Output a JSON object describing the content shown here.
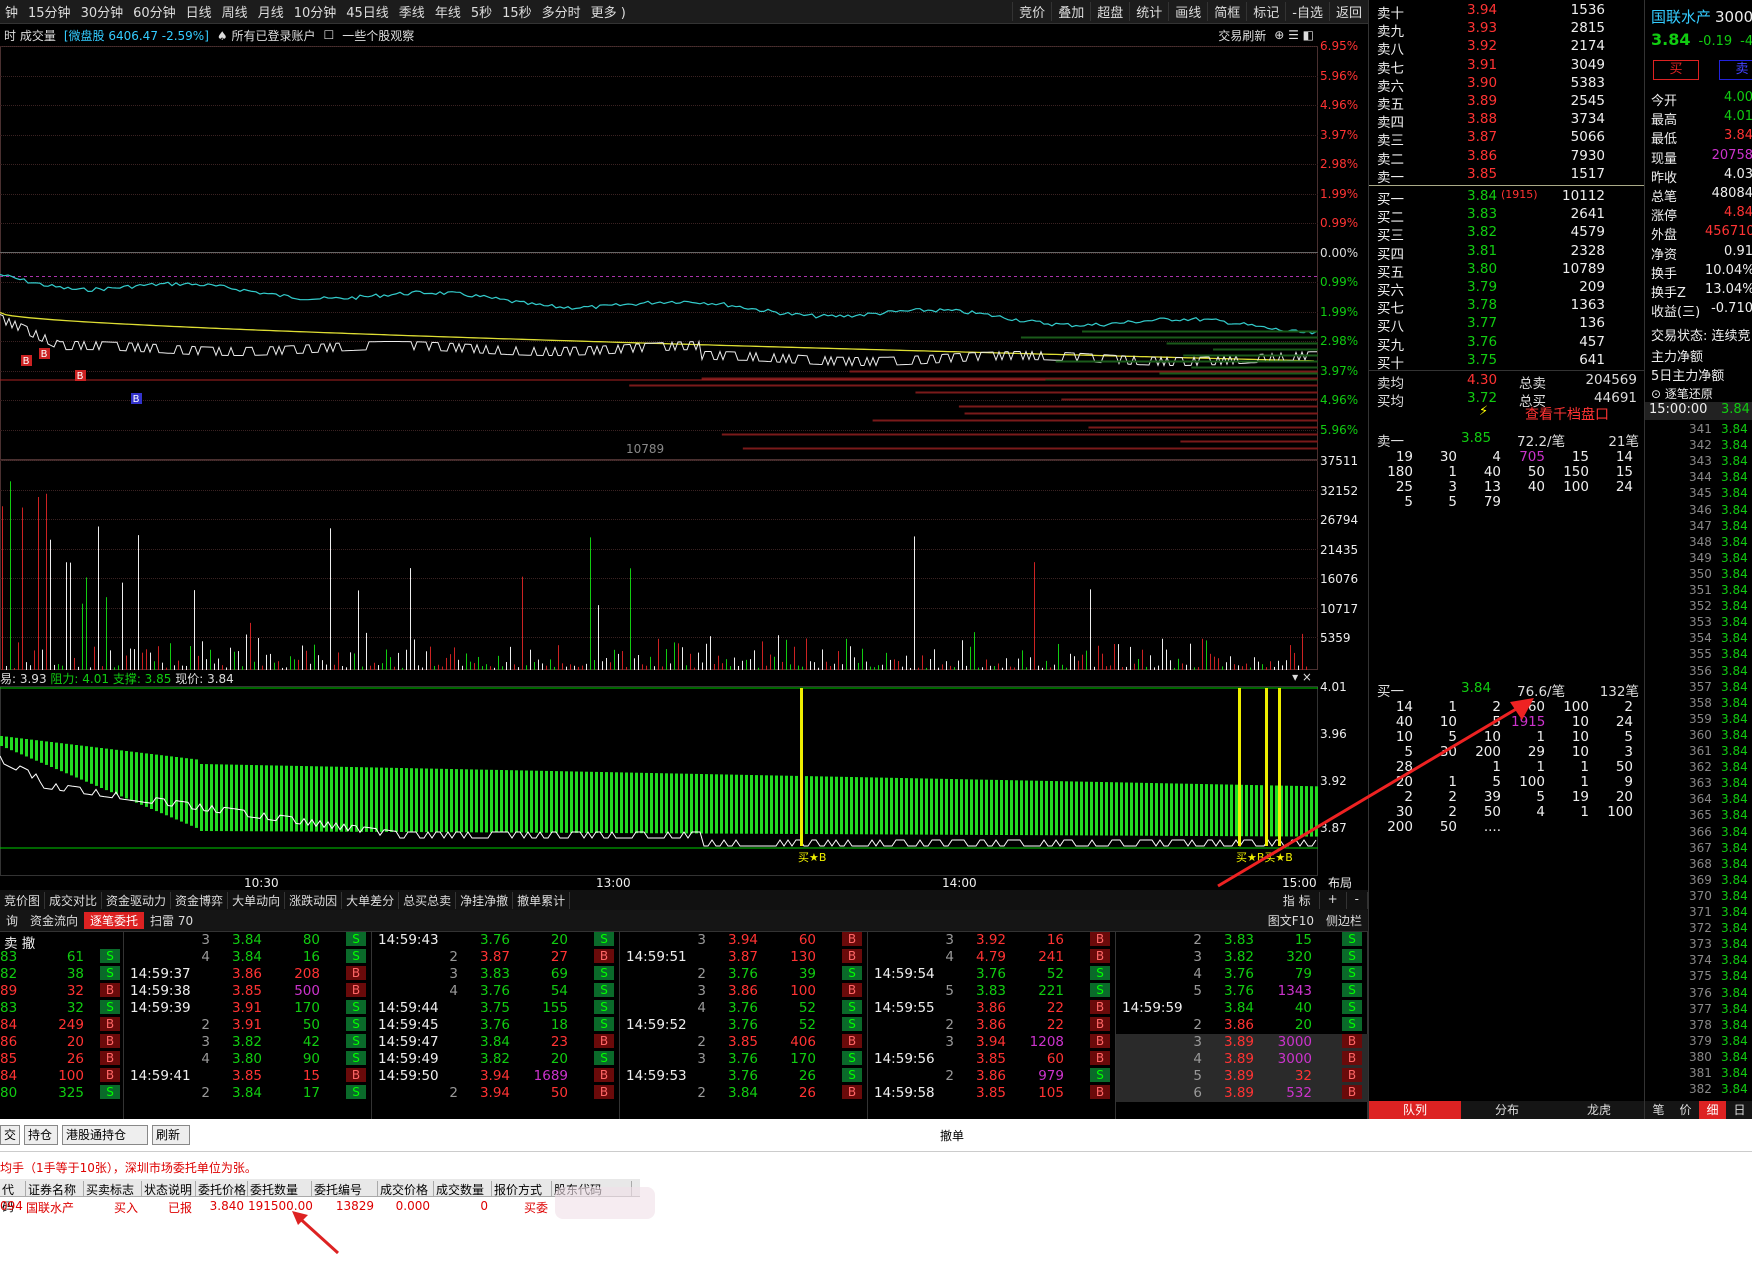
{
  "topbar": {
    "left": [
      "钟",
      "15分钟",
      "30分钟",
      "60分钟",
      "日线",
      "周线",
      "月线",
      "10分钟",
      "45日线",
      "季线",
      "年线",
      "5秒",
      "15秒",
      "多分时",
      "更多 )"
    ],
    "right": [
      "竞价",
      "叠加",
      "超盘",
      "统计",
      "画线",
      "简框",
      "标记",
      "-自选",
      "返回"
    ]
  },
  "infobar": {
    "a": "时 成交量",
    "b": "[微盘股 6406.47 -2.59%]",
    "c": "♠ 所有已登录账户",
    "d": "一些个股观察",
    "e": "交易刷新"
  },
  "price_axis": [
    "6.95%",
    "5.96%",
    "4.96%",
    "3.97%",
    "2.98%",
    "1.99%",
    "0.99%",
    "0.00%",
    "0.99%",
    "1.99%",
    "2.98%",
    "3.97%",
    "4.96%",
    "5.96%"
  ],
  "vol_axis": [
    "37511",
    "32152",
    "26794",
    "21435",
    "16076",
    "10717",
    "5359"
  ],
  "vol_label": "10789",
  "ind_header": {
    "a": "易: 3.93",
    "b": "阻力: 4.01",
    "c": "支撑: 3.85",
    "d": "现价: 3.84"
  },
  "ind_axis": [
    "4.01",
    "3.96",
    "3.92",
    "3.87"
  ],
  "markers": {
    "b1": "B",
    "b2": "B",
    "b3": "B",
    "b4": "B",
    "buy1": "买★B",
    "buy2": "买★B买★B"
  },
  "time_axis": [
    "10:30",
    "13:00",
    "14:00",
    "15:00"
  ],
  "layout_btn": "布局",
  "tabs1": [
    "竞价图",
    "成交对比",
    "资金驱动力",
    "资金博弈",
    "大单动向",
    "涨跌动因",
    "大单差分",
    "总买总卖",
    "净挂净撤",
    "撤单累计"
  ],
  "tabs1_right": [
    "指 标",
    "+",
    "-"
  ],
  "tabs2": [
    "询",
    "资金流向",
    "逐笔委托",
    "扫雷 70"
  ],
  "tabs2_right": [
    "图文F10",
    "侧边栏"
  ],
  "tape": {
    "col0": {
      "header": "卖 撤",
      "rows": [
        [
          "83",
          "61",
          "S"
        ],
        [
          "82",
          "38",
          "S"
        ],
        [
          "89",
          "32",
          "B"
        ],
        [
          "83",
          "32",
          "S"
        ],
        [
          "84",
          "249",
          "B"
        ],
        [
          "86",
          "20",
          "B"
        ],
        [
          "85",
          "26",
          "B"
        ],
        [
          "84",
          "100",
          "B"
        ],
        [
          "80",
          "325",
          "S"
        ]
      ]
    },
    "col1": [
      [
        "",
        "3",
        "3.84",
        "80",
        "S"
      ],
      [
        "",
        "4",
        "3.84",
        "16",
        "S"
      ],
      [
        "14:59:37",
        "",
        "3.86",
        "208",
        "B"
      ],
      [
        "14:59:38",
        "",
        "3.85",
        "500",
        "B"
      ],
      [
        "14:59:39",
        "",
        "3.91",
        "170",
        "S"
      ],
      [
        "",
        "2",
        "3.91",
        "50",
        "S"
      ],
      [
        "",
        "3",
        "3.82",
        "42",
        "S"
      ],
      [
        "",
        "4",
        "3.80",
        "90",
        "S"
      ],
      [
        "14:59:41",
        "",
        "3.85",
        "15",
        "B"
      ],
      [
        "",
        "2",
        "3.84",
        "17",
        "S"
      ]
    ],
    "col2": [
      [
        "14:59:43",
        "",
        "3.76",
        "20",
        "S"
      ],
      [
        "",
        "2",
        "3.87",
        "27",
        "B"
      ],
      [
        "",
        "3",
        "3.83",
        "69",
        "S"
      ],
      [
        "",
        "4",
        "3.76",
        "54",
        "S"
      ],
      [
        "14:59:44",
        "",
        "3.75",
        "155",
        "S"
      ],
      [
        "14:59:45",
        "",
        "3.76",
        "18",
        "S"
      ],
      [
        "14:59:47",
        "",
        "3.84",
        "23",
        "B"
      ],
      [
        "14:59:49",
        "",
        "3.82",
        "20",
        "S"
      ],
      [
        "14:59:50",
        "",
        "3.94",
        "1689",
        "B"
      ],
      [
        "",
        "2",
        "3.94",
        "50",
        "B"
      ]
    ],
    "col3": [
      [
        "",
        "3",
        "3.94",
        "60",
        "B"
      ],
      [
        "14:59:51",
        "",
        "3.87",
        "130",
        "B"
      ],
      [
        "",
        "2",
        "3.76",
        "39",
        "S"
      ],
      [
        "",
        "3",
        "3.86",
        "100",
        "B"
      ],
      [
        "",
        "4",
        "3.76",
        "52",
        "S"
      ],
      [
        "14:59:52",
        "",
        "3.76",
        "52",
        "S"
      ],
      [
        "",
        "2",
        "3.85",
        "406",
        "B"
      ],
      [
        "",
        "3",
        "3.76",
        "170",
        "S"
      ],
      [
        "14:59:53",
        "",
        "3.76",
        "26",
        "S"
      ],
      [
        "",
        "2",
        "3.84",
        "26",
        "B"
      ]
    ],
    "col4": [
      [
        "",
        "3",
        "3.92",
        "16",
        "B"
      ],
      [
        "",
        "4",
        "4.79",
        "241",
        "B"
      ],
      [
        "14:59:54",
        "",
        "3.76",
        "52",
        "S"
      ],
      [
        "",
        "5",
        "3.83",
        "221",
        "S"
      ],
      [
        "14:59:55",
        "",
        "3.86",
        "22",
        "B"
      ],
      [
        "",
        "2",
        "3.86",
        "22",
        "B"
      ],
      [
        "",
        "3",
        "3.94",
        "1208",
        "B"
      ],
      [
        "14:59:56",
        "",
        "3.85",
        "60",
        "B"
      ],
      [
        "",
        "2",
        "3.86",
        "979",
        "S"
      ],
      [
        "14:59:58",
        "",
        "3.85",
        "105",
        "B"
      ]
    ],
    "col5": [
      [
        "",
        "2",
        "3.83",
        "15",
        "S"
      ],
      [
        "",
        "3",
        "3.82",
        "320",
        "S"
      ],
      [
        "",
        "4",
        "3.76",
        "79",
        "S"
      ],
      [
        "",
        "5",
        "3.76",
        "1343",
        "S"
      ],
      [
        "14:59:59",
        "",
        "3.84",
        "40",
        "S"
      ],
      [
        "",
        "2",
        "3.86",
        "20",
        "S"
      ],
      [
        "",
        "3",
        "3.89",
        "3000",
        "B"
      ],
      [
        "",
        "4",
        "3.89",
        "3000",
        "B"
      ],
      [
        "",
        "5",
        "3.89",
        "32",
        "B"
      ],
      [
        "",
        "6",
        "3.89",
        "532",
        "B"
      ]
    ]
  },
  "orderbook": {
    "asks": [
      [
        "卖十",
        "3.94",
        "1536"
      ],
      [
        "卖九",
        "3.93",
        "2815"
      ],
      [
        "卖八",
        "3.92",
        "2174"
      ],
      [
        "卖七",
        "3.91",
        "3049"
      ],
      [
        "卖六",
        "3.90",
        "5383"
      ],
      [
        "卖五",
        "3.89",
        "2545"
      ],
      [
        "卖四",
        "3.88",
        "3734"
      ],
      [
        "卖三",
        "3.87",
        "5066"
      ],
      [
        "卖二",
        "3.86",
        "7930"
      ],
      [
        "卖一",
        "3.85",
        "1517"
      ]
    ],
    "bids": [
      [
        "买一",
        "3.84",
        "10112"
      ],
      [
        "买二",
        "3.83",
        "2641"
      ],
      [
        "买三",
        "3.82",
        "4579"
      ],
      [
        "买四",
        "3.81",
        "2328"
      ],
      [
        "买五",
        "3.80",
        "10789"
      ],
      [
        "买六",
        "3.79",
        "209"
      ],
      [
        "买七",
        "3.78",
        "1363"
      ],
      [
        "买八",
        "3.77",
        "136"
      ],
      [
        "买九",
        "3.76",
        "457"
      ],
      [
        "买十",
        "3.75",
        "641"
      ]
    ],
    "bid1_extra": "(1915)",
    "sell_avg_label": "卖均",
    "sell_avg": "4.30",
    "total_sell_label": "总卖",
    "total_sell": "204569",
    "buy_avg_label": "买均",
    "buy_avg": "3.72",
    "total_buy_label": "总买",
    "total_buy": "44691",
    "view_1000": "查看千档盘口",
    "ask1_queue": {
      "label": "卖一",
      "price": "3.85",
      "avg": "72.2/笔",
      "count": "21笔",
      "rows": [
        [
          "19",
          "30",
          "4",
          "705",
          "15",
          "14"
        ],
        [
          "180",
          "1",
          "40",
          "50",
          "150",
          "15"
        ],
        [
          "25",
          "3",
          "13",
          "40",
          "100",
          "24"
        ],
        [
          "5",
          "5",
          "79",
          "",
          "",
          ""
        ]
      ]
    },
    "bid1_queue": {
      "label": "买一",
      "price": "3.84",
      "avg": "76.6/笔",
      "count": "132笔",
      "rows": [
        [
          "14",
          "1",
          "2",
          "60",
          "100",
          "2"
        ],
        [
          "40",
          "10",
          "5",
          "1915",
          "10",
          "24"
        ],
        [
          "10",
          "5",
          "10",
          "1",
          "10",
          "5"
        ],
        [
          "5",
          "30",
          "200",
          "29",
          "10",
          "3"
        ],
        [
          "28",
          "",
          "1",
          "1",
          "1",
          "50"
        ],
        [
          "20",
          "1",
          "5",
          "100",
          "1",
          "9"
        ],
        [
          "2",
          "2",
          "39",
          "5",
          "19",
          "20"
        ],
        [
          "30",
          "2",
          "50",
          "4",
          "1",
          "100"
        ],
        [
          "200",
          "50",
          "....",
          "",
          "",
          ""
        ]
      ]
    },
    "bottom_tabs": [
      "队列",
      "分布",
      "龙虎"
    ]
  },
  "side": {
    "name": "国联水产",
    "code": "3000",
    "price": "3.84",
    "chg": "-0.19",
    "pct": "-4.",
    "buy": "买",
    "sell": "卖",
    "stats": [
      [
        "今开",
        "4.00"
      ],
      [
        "最高",
        "4.01"
      ],
      [
        "最低",
        "3.84"
      ],
      [
        "现量",
        "20758"
      ],
      [
        "昨收",
        "4.03"
      ],
      [
        "总笔",
        "48084"
      ],
      [
        "涨停",
        "4.84"
      ],
      [
        "外盘",
        "456710"
      ],
      [
        "净资",
        "0.91"
      ],
      [
        "换手",
        "10.04%"
      ],
      [
        "换手Z",
        "13.04%"
      ],
      [
        "收益(三)",
        "-0.710"
      ]
    ],
    "state": "交易状态: 连续竞",
    "main_net": "主力净额",
    "main_net5": "5日主力净额",
    "restore": "逐笔还原",
    "time_head": "15:00:00",
    "price_head": "3.84",
    "seq_start": 341,
    "seq_end": 382,
    "seq_price": "3.84",
    "bottom_tabs": [
      "笔",
      "价",
      "细",
      "日"
    ]
  },
  "bottom": {
    "buttons": [
      "交",
      "持仓",
      "港股通持仓",
      "刷新"
    ],
    "center_btn": "撤单",
    "notice": "均手（1手等于10张），深圳市场委托单位为张。",
    "headers": [
      "代码",
      "证券名称",
      "买卖标志",
      "状态说明",
      "委托价格",
      "委托数量",
      "委托编号",
      "成交价格",
      "成交数量",
      "报价方式",
      "股东代码"
    ],
    "row": [
      "094",
      "国联水产",
      "买入",
      "已报",
      "3.840",
      "191500.00",
      "13829",
      "0.000",
      "0",
      "买委",
      ""
    ]
  },
  "colors": {
    "up": "#ff3333",
    "down": "#11cc11",
    "accent": "#ffff00",
    "purple": "#cc33cc"
  }
}
